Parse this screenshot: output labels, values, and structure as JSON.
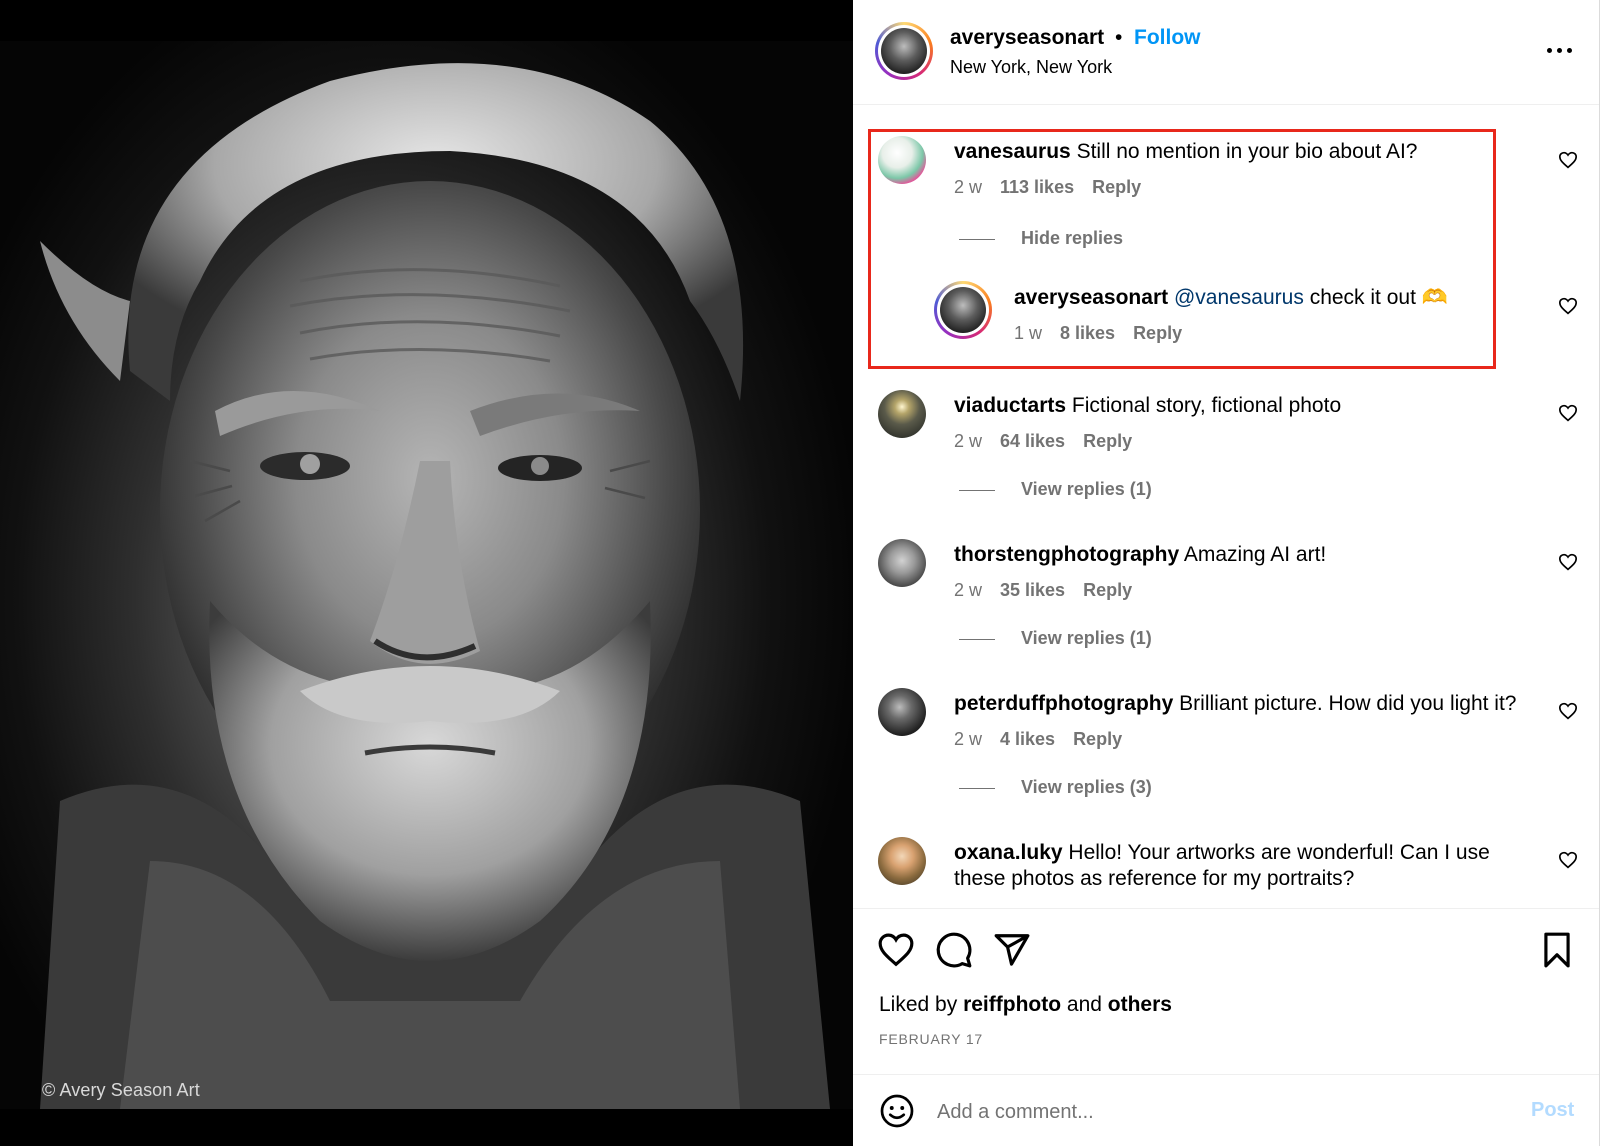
{
  "photo": {
    "watermark": "© Avery Season Art"
  },
  "header": {
    "username": "averyseasonart",
    "separator": "•",
    "follow_label": "Follow",
    "location": "New York, New York",
    "more_icon": "more-horizontal-icon"
  },
  "comments": [
    {
      "username": "vanesaurus",
      "text": "Still no mention in your bio about AI?",
      "age": "2 w",
      "likes": "113 likes",
      "reply_label": "Reply",
      "replies_toggle": "Hide replies",
      "highlighted": true
    },
    {
      "username": "averyseasonart",
      "mention": "@vanesaurus",
      "text": "check it out 🫶",
      "age": "1 w",
      "likes": "8 likes",
      "reply_label": "Reply",
      "is_reply": true
    },
    {
      "username": "viaductarts",
      "text": "Fictional story, fictional photo",
      "age": "2 w",
      "likes": "64 likes",
      "reply_label": "Reply",
      "replies_toggle": "View replies (1)"
    },
    {
      "username": "thorstengphotography",
      "text": "Amazing AI art!",
      "age": "2 w",
      "likes": "35 likes",
      "reply_label": "Reply",
      "replies_toggle": "View replies (1)"
    },
    {
      "username": "peterduffphotography",
      "text": "Brilliant picture. How did you light it?",
      "age": "2 w",
      "likes": "4 likes",
      "reply_label": "Reply",
      "replies_toggle": "View replies (3)"
    },
    {
      "username": "oxana.luky",
      "text": "Hello! Your artworks are wonderful! Can I use these photos as reference for my portraits?"
    }
  ],
  "actions": {
    "like_icon": "heart-icon",
    "comment_icon": "comment-icon",
    "share_icon": "send-icon",
    "save_icon": "bookmark-icon",
    "liked_by_prefix": "Liked by",
    "liked_by_user": "reiffphoto",
    "liked_by_and": "and",
    "liked_by_others": "others",
    "date": "FEBRUARY 17"
  },
  "add_comment": {
    "placeholder": "Add a comment...",
    "post_label": "Post",
    "emoji_icon": "emoji-icon"
  },
  "colors": {
    "link_blue": "#0095f6",
    "post_disabled": "#b3dbff",
    "highlight_red": "#e8281b",
    "muted": "#737373",
    "mention": "#00376b"
  }
}
